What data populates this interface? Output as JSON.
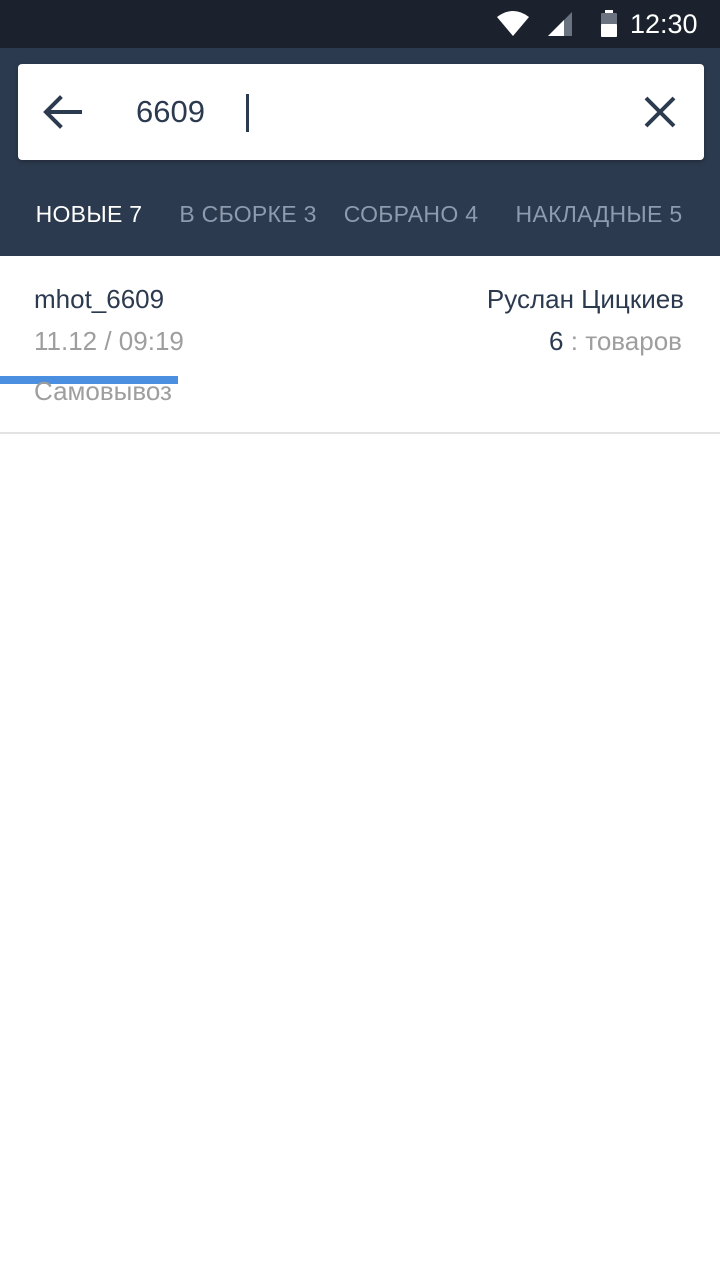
{
  "status_bar": {
    "time": "12:30",
    "icons": [
      "wifi-icon",
      "cell-signal-icon",
      "battery-icon"
    ]
  },
  "search": {
    "query": "6609",
    "icons": {
      "back": "arrow-back-icon",
      "clear": "close-icon"
    }
  },
  "tabs": [
    {
      "label": "НОВЫЕ 7",
      "active": true
    },
    {
      "label": "В СБОРКЕ 3",
      "active": false
    },
    {
      "label": "СОБРАНО 4",
      "active": false
    },
    {
      "label": "НАКЛАДНЫЕ 5",
      "active": false
    }
  ],
  "orders": [
    {
      "id": "mhot_6609",
      "datetime": "11.12 / 09:19",
      "delivery": "Самовывоз",
      "customer": "Руслан Цицкиев",
      "items_count": "6",
      "items_label": ": товаров"
    }
  ],
  "colors": {
    "status_bar_bg": "#1b222d",
    "appbar_bg": "#2c3a4f",
    "tab_indicator": "#4a8fe0",
    "text_primary": "#2c3a4f",
    "text_secondary": "#9e9e9e"
  }
}
